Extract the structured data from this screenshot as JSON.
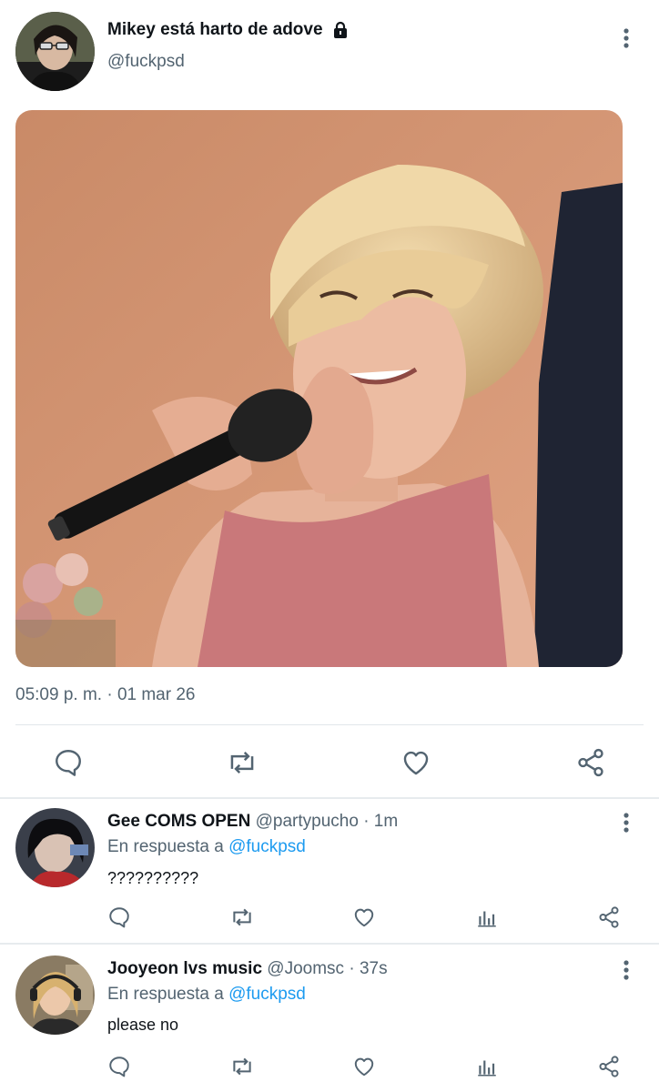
{
  "tweet": {
    "author_name": "Mikey está harto de adove",
    "author_handle": "@fuckpsd",
    "timestamp": "05:09 p. m. · 01 mar 26",
    "icons": [
      "lock-icon",
      "more-vertical-icon",
      "reply-icon",
      "retweet-icon",
      "like-icon",
      "share-icon"
    ]
  },
  "replies": [
    {
      "name": "Gee COMS OPEN",
      "handle": "@partypucho",
      "time": "1m",
      "reply_prefix": "En respuesta a ",
      "reply_mention": "@fuckpsd",
      "text": "??????????"
    },
    {
      "name": "Jooyeon lvs music",
      "handle": "@Joomsc",
      "time": "37s",
      "reply_prefix": "En respuesta a ",
      "reply_mention": "@fuckpsd",
      "text": "please no"
    }
  ],
  "colors": {
    "text": "#0f1419",
    "muted": "#536471",
    "link": "#1d9bf0",
    "divider": "#e1e6ea"
  }
}
